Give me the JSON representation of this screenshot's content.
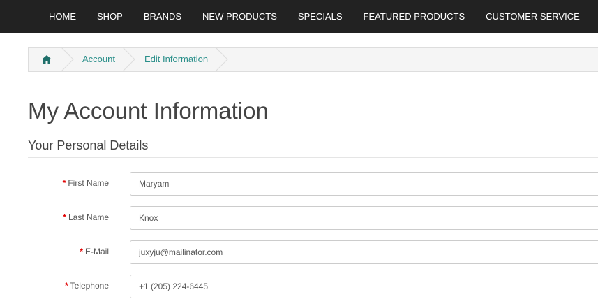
{
  "nav": {
    "items": [
      "HOME",
      "SHOP",
      "BRANDS",
      "NEW PRODUCTS",
      "SPECIALS",
      "FEATURED PRODUCTS",
      "CUSTOMER SERVICE"
    ]
  },
  "breadcrumb": {
    "home_icon": "home-icon",
    "items": [
      "Account",
      "Edit Information"
    ]
  },
  "page": {
    "title": "My Account Information",
    "section": "Your Personal Details"
  },
  "form": {
    "required_mark": "*",
    "fields": [
      {
        "label": "First Name",
        "value": "Maryam"
      },
      {
        "label": "Last Name",
        "value": "Knox"
      },
      {
        "label": "E-Mail",
        "value": "juxyju@mailinator.com"
      },
      {
        "label": "Telephone",
        "value": "+1 (205) 224-6445"
      }
    ]
  },
  "colors": {
    "nav_bg": "#222222",
    "link": "#2a8f8a",
    "required": "#e10000"
  }
}
